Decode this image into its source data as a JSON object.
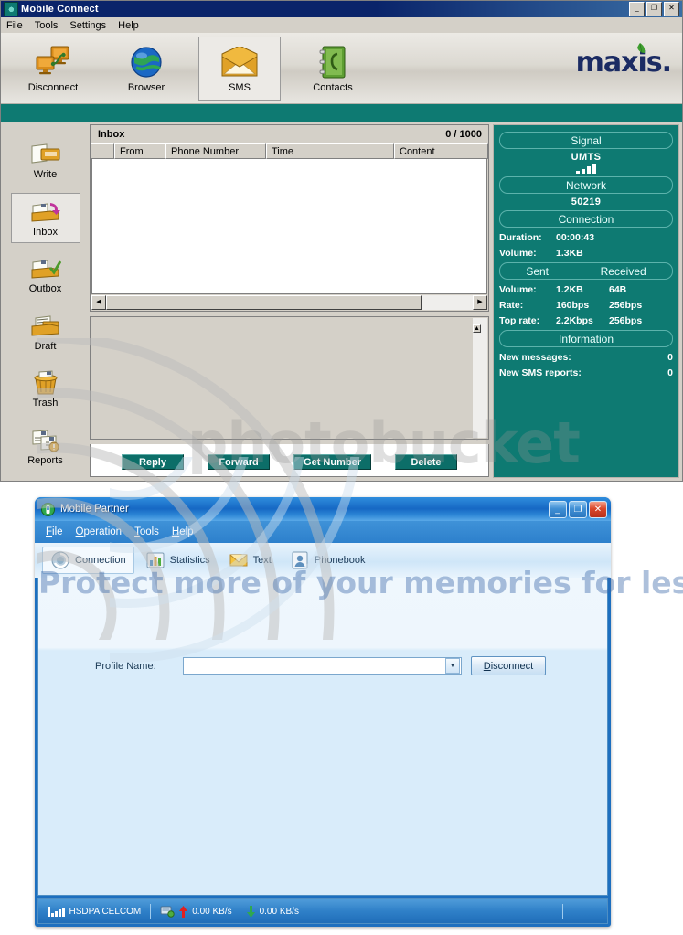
{
  "window1": {
    "title": "Mobile Connect",
    "title_icon": "app-teal-icon",
    "controls": [
      {
        "name": "minimize",
        "glyph": "_"
      },
      {
        "name": "maximize",
        "glyph": "❐"
      },
      {
        "name": "close",
        "glyph": "✕"
      }
    ],
    "menu": [
      "File",
      "Tools",
      "Settings",
      "Help"
    ],
    "toolbar": [
      {
        "label": "Disconnect",
        "icon": "two-computers-icon",
        "selected": false
      },
      {
        "label": "Browser",
        "icon": "globe-icon",
        "selected": false
      },
      {
        "label": "SMS",
        "icon": "open-envelope-icon",
        "selected": true
      },
      {
        "label": "Contacts",
        "icon": "address-book-icon",
        "selected": false
      }
    ],
    "brand": {
      "word": "maxis",
      "dot": ".",
      "leaf_icon": "green-leaf-icon",
      "color": "#1b2b63",
      "leaf_color": "#4fae3f"
    },
    "sidebar": [
      {
        "label": "Write",
        "icon": "write-message-icon",
        "selected": false
      },
      {
        "label": "Inbox",
        "icon": "inbox-tray-icon",
        "selected": true
      },
      {
        "label": "Outbox",
        "icon": "outbox-check-icon",
        "selected": false
      },
      {
        "label": "Draft",
        "icon": "draft-tray-icon",
        "selected": false
      },
      {
        "label": "Trash",
        "icon": "trash-basket-icon",
        "selected": false
      },
      {
        "label": "Reports",
        "icon": "reports-pages-icon",
        "selected": false
      }
    ],
    "list": {
      "header_title": "Inbox",
      "counter": "0 / 1000",
      "columns": [
        "",
        "From",
        "Phone Number",
        "Time",
        "Content"
      ],
      "rows": []
    },
    "buttons": [
      "Reply",
      "Forward",
      "Get Number",
      "Delete"
    ],
    "status_panel": {
      "signal_header": "Signal",
      "network_type": "UMTS",
      "signal_bars": 4,
      "network_header": "Network",
      "network_id": "50219",
      "connection_header": "Connection",
      "duration_label": "Duration:",
      "duration_value": "00:00:43",
      "volume_label": "Volume:",
      "volume_value": "1.3KB",
      "sent_header": "Sent",
      "received_header": "Received",
      "rows": [
        {
          "label": "Volume:",
          "sent": "1.2KB",
          "received": "64B"
        },
        {
          "label": "Rate:",
          "sent": "160bps",
          "received": "256bps"
        },
        {
          "label": "Top rate:",
          "sent": "2.2Kbps",
          "received": "256bps"
        }
      ],
      "information_header": "Information",
      "info": [
        {
          "label": "New messages:",
          "value": "0"
        },
        {
          "label": "New SMS reports:",
          "value": "0"
        }
      ]
    }
  },
  "window2": {
    "title": "Mobile Partner",
    "title_icon": "mobile-partner-icon",
    "controls": [
      {
        "name": "minimize",
        "glyph": "_"
      },
      {
        "name": "maximize",
        "glyph": "❐"
      },
      {
        "name": "close",
        "glyph": "✕"
      }
    ],
    "menu": [
      "File",
      "Operation",
      "Tools",
      "Help"
    ],
    "tabs": [
      {
        "label": "Connection",
        "icon": "connection-globe-icon",
        "selected": true
      },
      {
        "label": "Statistics",
        "icon": "bar-chart-icon",
        "selected": false
      },
      {
        "label": "Text",
        "icon": "envelope-icon",
        "selected": false
      },
      {
        "label": "Phonebook",
        "icon": "contacts-book-icon",
        "selected": false
      }
    ],
    "profile": {
      "label": "Profile Name:",
      "value": "",
      "placeholder": "",
      "dropdown_icon": "chevron-down-icon",
      "button": "Disconnect"
    },
    "status_bar": {
      "signal_icon": "signal-bars-icon",
      "signal_bars": 5,
      "network": "HSDPA  CELCOM",
      "transfer_icon": "network-transfer-icon",
      "upload_icon": "up-arrow-icon",
      "upload": "0.00 KB/s",
      "download_icon": "down-arrow-icon",
      "download": "0.00 KB/s"
    }
  },
  "watermark": {
    "brand": "photobucket",
    "tagline": "Protect more of your memories for les"
  }
}
